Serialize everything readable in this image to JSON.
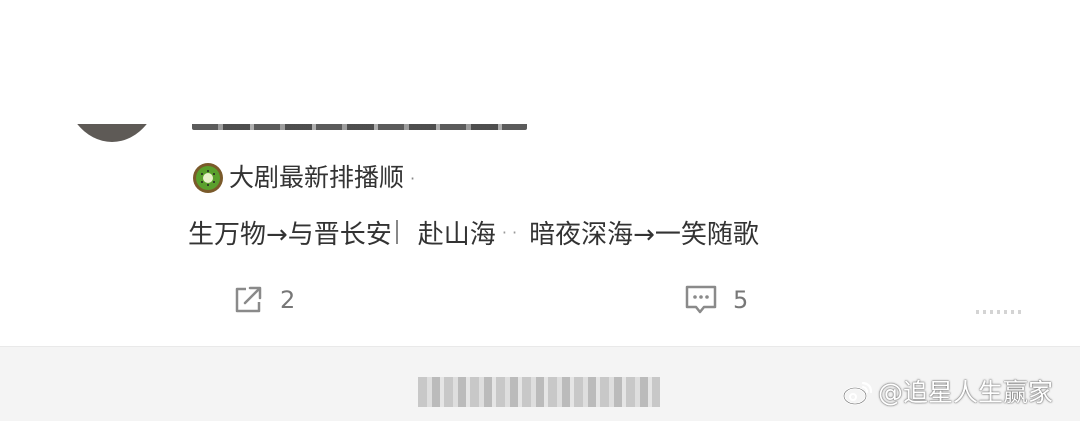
{
  "post": {
    "headline": "大剧最新排播顺",
    "schedule": {
      "part1": "生万物→与晋长安",
      "part2": "赴山海",
      "part3": "暗夜深海→一笑随歌"
    },
    "share_count": "2",
    "comment_count": "5"
  },
  "icons": {
    "headline_emoji": "kiwi-icon",
    "share": "share-icon",
    "comment": "comment-icon",
    "watermark_logo": "weibo-logo-icon"
  },
  "watermark": {
    "text": "@追星人生赢家"
  },
  "colors": {
    "text": "#333333",
    "muted": "#777777",
    "kiwi_green": "#5aa02c",
    "kiwi_skin": "#7a5a2a"
  }
}
